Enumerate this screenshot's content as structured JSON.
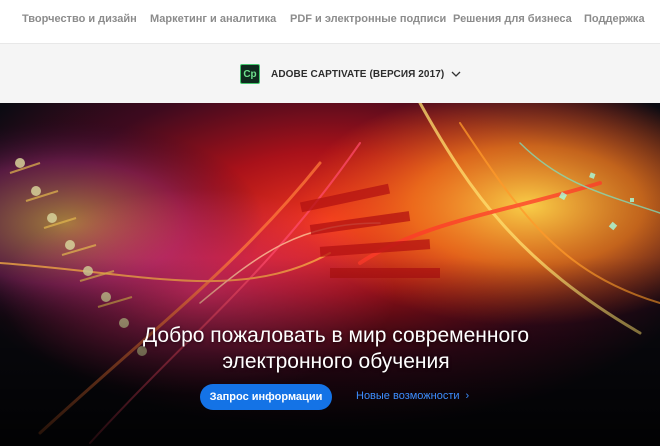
{
  "top_nav": {
    "items": [
      {
        "label": "Творчество и дизайн"
      },
      {
        "label": "Маркетинг и аналитика"
      },
      {
        "label": "PDF и электронные подписи"
      },
      {
        "label": "Решения для бизнеса"
      },
      {
        "label": "Поддержка"
      }
    ]
  },
  "product_nav": {
    "logo_text": "Cp",
    "product_name": "ADOBE CAPTIVATE (ВЕРСИЯ 2017)",
    "icon": "chevron-down-icon"
  },
  "hero": {
    "title_line1": "Добро пожаловать в мир современного",
    "title_line2": "электронного обучения",
    "cta_label": "Запрос информации",
    "link_label": "Новые возможности",
    "link_arrow": "›"
  },
  "colors": {
    "cta_background": "#1473e6",
    "link": "#3d8eff",
    "logo_border": "#46c66e"
  }
}
